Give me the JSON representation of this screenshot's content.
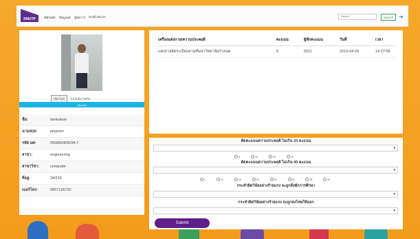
{
  "navbar": {
    "logo_text": "RMUTP",
    "links": [
      "หน้าแรก",
      "ข้อมูลนศ",
      "ผู้จัดการ",
      "Notifications"
    ],
    "search_placeholder": "Search",
    "search_button": "Search"
  },
  "profile": {
    "file_button": "เลือกไฟล์",
    "file_status": "ไม่ได้เลือกไฟล์ใด",
    "upload_label": "Upload",
    "fields": [
      {
        "label": "ชื่อ:",
        "value": "donkatam"
      },
      {
        "label": "นามสกุล:",
        "value": "pinprom"
      },
      {
        "label": "รหัส นศ:",
        "value": "055850405034-7"
      },
      {
        "label": "สาขา:",
        "value": "engineering"
      },
      {
        "label": "สาขาวิชา:",
        "value": "computer"
      },
      {
        "label": "ที่อยู่:",
        "value": "34/315"
      },
      {
        "label": "เบอร์โทร:",
        "value": "0857126720"
      }
    ]
  },
  "records": {
    "headers": [
      "เครื่องแต่งกาย/ความประพฤติ",
      "คะแนน",
      "ผู้หักคะแนน",
      "วันที่",
      "เวลา"
    ],
    "rows": [
      [
        "แต่งกายผิดระเบียบตามที่มหาวิทยาลัยกำหนด",
        "5",
        "0311",
        "2019-04-29",
        "14:37:58"
      ]
    ]
  },
  "form": {
    "q1_title": "ตัดคะแนนความประพฤติ ไม่เกิน 20 คะแนน",
    "q1_options": [
      "5",
      "10",
      "15",
      "20"
    ],
    "q2_title": "ตัดคะแนนความประพฤติ ไม่เกิน 40 คะแนน",
    "q2_options": [
      "5",
      "10",
      "15",
      "20",
      "25",
      "30",
      "35",
      "40"
    ],
    "q3_title": "กระทำผิดวินัยอย่างร้ายแรง จะถูกสั่งพักการศึกษา",
    "q4_title": "กระทำผิดวินัยอย่างร้ายแรง จะถูกลงโทษให้ออก",
    "submit_label": "Submit"
  },
  "colors": {
    "accent": "#5f1e8c",
    "upload": "#1cb5e8",
    "background": "#f4a623"
  }
}
